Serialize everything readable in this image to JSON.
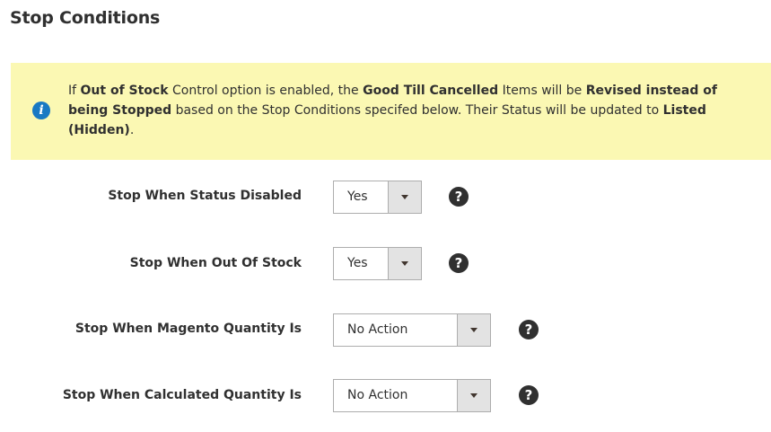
{
  "section": {
    "title": "Stop Conditions"
  },
  "notice": {
    "icon": "info-icon",
    "parts": [
      {
        "text": "If ",
        "bold": false
      },
      {
        "text": "Out of Stock",
        "bold": true
      },
      {
        "text": " Control option is enabled, the ",
        "bold": false
      },
      {
        "text": "Good Till Cancelled",
        "bold": true
      },
      {
        "text": " Items will be ",
        "bold": false
      },
      {
        "text": "Revised instead of being Stopped",
        "bold": true
      },
      {
        "text": " based on the Stop Conditions specifed below. Their Status will be updated to ",
        "bold": false
      },
      {
        "text": "Listed (Hidden)",
        "bold": true
      },
      {
        "text": ".",
        "bold": false
      }
    ],
    "background": "#fbf8b3",
    "icon_color": "#1979c3"
  },
  "fields": [
    {
      "label": "Stop When Status Disabled",
      "value": "Yes",
      "help_icon": "question-circle-icon"
    },
    {
      "label": "Stop When Out Of Stock",
      "value": "Yes",
      "help_icon": "question-circle-icon"
    },
    {
      "label": "Stop When Magento Quantity Is",
      "value": "No Action",
      "help_icon": "question-circle-icon"
    },
    {
      "label": "Stop When Calculated Quantity Is",
      "value": "No Action",
      "help_icon": "question-circle-icon"
    }
  ]
}
